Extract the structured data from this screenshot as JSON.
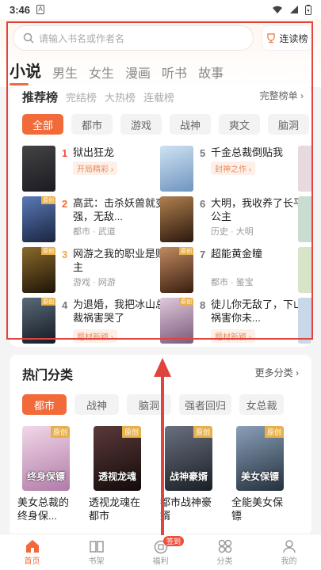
{
  "status": {
    "time": "3:46",
    "sim": "A"
  },
  "search": {
    "placeholder": "请输入书名或作者名",
    "rank_button": "连读榜"
  },
  "tabs": [
    "小说",
    "男生",
    "女生",
    "漫画",
    "听书",
    "故事"
  ],
  "rank_tabs": [
    "推荐榜",
    "完结榜",
    "大热榜",
    "连载榜"
  ],
  "full_rank": "完整榜单 ›",
  "chips": [
    "全部",
    "都市",
    "游戏",
    "战神",
    "爽文",
    "脑洞"
  ],
  "ranked_books": [
    {
      "rank": "1",
      "title": "狱出狂龙",
      "tag": "开局精彩 ›",
      "meta": "",
      "color": "#2b2b33"
    },
    {
      "rank": "2",
      "title": "高武：击杀妖兽就变强，无敌...",
      "tag": "",
      "meta": "都市 · 武道",
      "color": "#2f4a7a"
    },
    {
      "rank": "3",
      "title": "网游之我的职业是财主",
      "tag": "",
      "meta": "游戏 · 网游",
      "color": "#3a2a1a"
    },
    {
      "rank": "4",
      "title": "为退婚，我把冰山总裁祸害哭了",
      "tag": "题材新颖 ›",
      "meta": "",
      "color": "#222c3a"
    },
    {
      "rank": "5",
      "title": "千金总裁倒贴我",
      "tag": "封神之作 ›",
      "meta": "",
      "color": "#8fb6d8"
    },
    {
      "rank": "6",
      "title": "大明，我收养了长平公主",
      "tag": "",
      "meta": "历史 · 大明",
      "color": "#4a3020"
    },
    {
      "rank": "7",
      "title": "超能黄金瞳",
      "tag": "",
      "meta": "都市 · 鉴宝",
      "color": "#5a3a2a"
    },
    {
      "rank": "8",
      "title": "徒儿你无敌了，下山祸害你未...",
      "tag": "题材新颖 ›",
      "meta": "",
      "color": "#a88aa8"
    }
  ],
  "hot": {
    "title": "热门分类",
    "more": "更多分类 ›",
    "chips": [
      "都市",
      "战神",
      "脑洞",
      "强者回归",
      "女总裁"
    ],
    "books": [
      {
        "name": "美女总裁的终身保...",
        "cover_text": "终身保镖",
        "tag": "原创",
        "color": "#d6a8c8"
      },
      {
        "name": "透视龙魂在都市",
        "cover_text": "透视龙魂",
        "tag": "原创",
        "color": "#2a1e1e"
      },
      {
        "name": "都市战神豪婿",
        "cover_text": "战神豪婿",
        "tag": "原创",
        "color": "#2b3038"
      },
      {
        "name": "全能美女保镖",
        "cover_text": "美女保镖",
        "tag": "原创",
        "color": "#3a4a5a"
      }
    ]
  },
  "nav": [
    {
      "label": "首页",
      "icon": "home-icon"
    },
    {
      "label": "书架",
      "icon": "bookshelf-icon"
    },
    {
      "label": "福利",
      "icon": "gift-icon",
      "badge": "签到"
    },
    {
      "label": "分类",
      "icon": "category-icon"
    },
    {
      "label": "我的",
      "icon": "profile-icon"
    }
  ]
}
